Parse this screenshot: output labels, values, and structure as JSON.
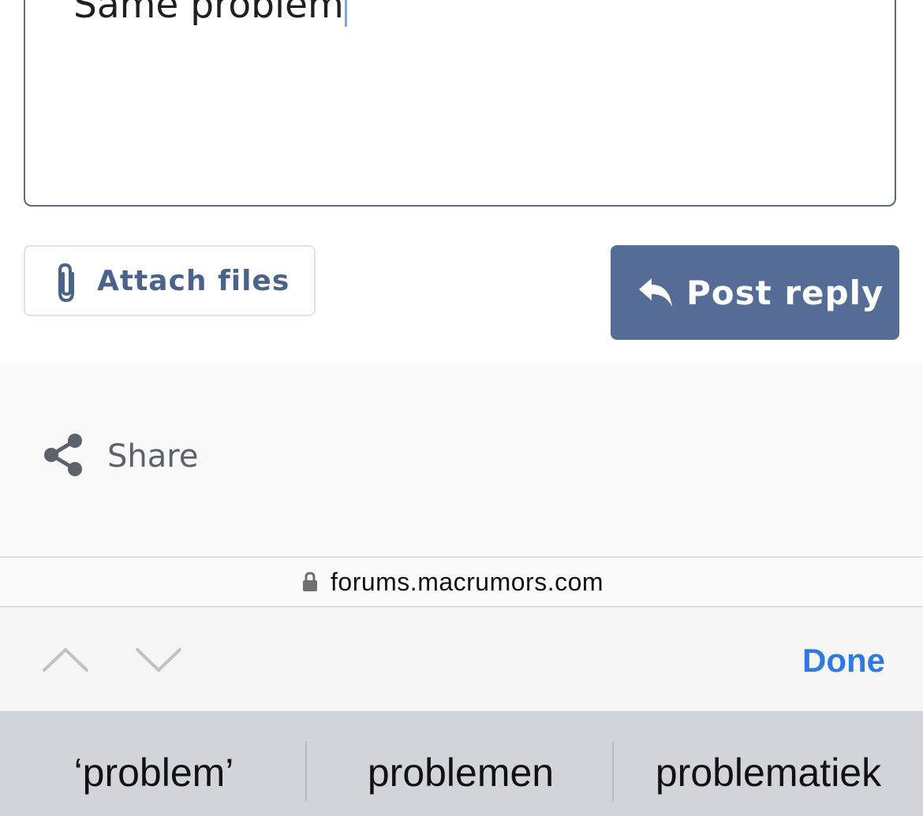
{
  "editor": {
    "text": "Same problem"
  },
  "actions": {
    "attach_label": "Attach files",
    "post_reply_label": "Post reply"
  },
  "share": {
    "label": "Share"
  },
  "browser": {
    "url": "forums.macrumors.com"
  },
  "keyboard_toolbar": {
    "done_label": "Done"
  },
  "predictive": {
    "suggestions": [
      "‘problem’",
      "problemen",
      "problematiek"
    ]
  },
  "colors": {
    "post_button_bg": "#546c96",
    "attach_text": "#4b638a",
    "done_text": "#2d7ae3",
    "caret": "#7aa7e6"
  },
  "icons": {
    "attach": "paperclip-icon",
    "post": "reply-arrow-icon",
    "share": "share-icon",
    "lock": "lock-icon",
    "prev": "chevron-up-icon",
    "next": "chevron-down-icon"
  }
}
